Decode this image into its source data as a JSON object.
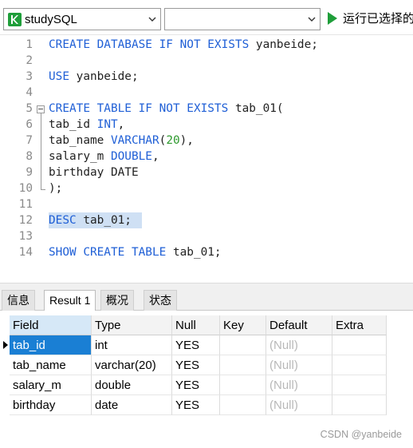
{
  "toolbar": {
    "database_select": "studySQL",
    "second_select": "",
    "run_label": "运行已选择的"
  },
  "editor": {
    "line_numbers": [
      "1",
      "2",
      "3",
      "4",
      "5",
      "6",
      "7",
      "8",
      "9",
      "10",
      "11",
      "12",
      "13",
      "14"
    ]
  },
  "tabs": [
    {
      "label": "信息"
    },
    {
      "label": "Result 1"
    },
    {
      "label": "概况"
    },
    {
      "label": "状态"
    }
  ],
  "result": {
    "columns": [
      "Field",
      "Type",
      "Null",
      "Key",
      "Default",
      "Extra"
    ],
    "rows": [
      [
        "tab_id",
        "int",
        "YES",
        "",
        "(Null)",
        ""
      ],
      [
        "tab_name",
        "varchar(20)",
        "YES",
        "",
        "(Null)",
        ""
      ],
      [
        "salary_m",
        "double",
        "YES",
        "",
        "(Null)",
        ""
      ],
      [
        "birthday",
        "date",
        "YES",
        "",
        "(Null)",
        ""
      ]
    ]
  },
  "watermark": "CSDN @yanbeide",
  "colors": {
    "accent": "#1a7fd4",
    "keyword": "#1f5fd6",
    "number": "#2e9a2e",
    "selection": "#cfe0f4"
  }
}
